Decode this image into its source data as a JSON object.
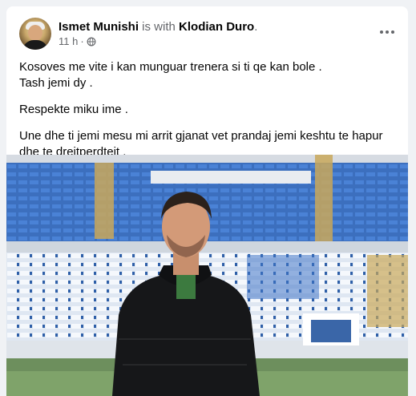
{
  "post": {
    "author": "Ismet Munishi",
    "with_text": " is with ",
    "tagged": "Klodian Duro",
    "tagged_suffix": ".",
    "time": "11 h",
    "separator": "·",
    "privacy_icon": "globe-icon",
    "more_icon": "more-horizontal-icon",
    "paragraphs": [
      [
        "Kosoves me vite i kan munguar trenera si ti qe kan bole .",
        "Tash jemi dy ."
      ],
      [
        "Respekte miku ime ."
      ],
      [
        "Une dhe ti jemi mesu mi arrit gjanat vet prandaj jemi keshtu te hapur",
        "dhe te drejtperdtejt ."
      ]
    ]
  },
  "colors": {
    "background": "#f0f2f5",
    "card": "#ffffff",
    "secondary_text": "#65676b",
    "stadium_seats": "#3f74c7"
  }
}
